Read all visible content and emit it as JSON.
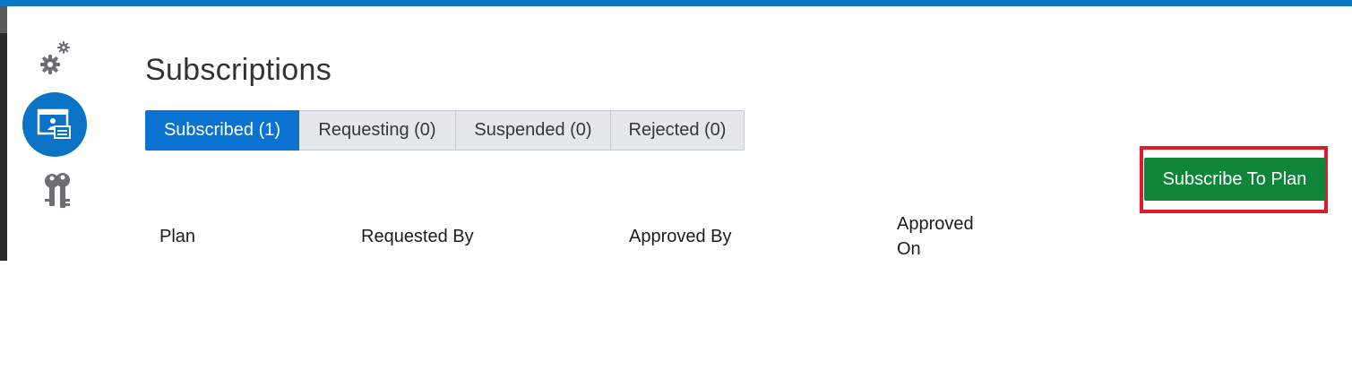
{
  "nav": {
    "items": [
      {
        "icon": "gears-icon",
        "active": false
      },
      {
        "icon": "subscriptions-icon",
        "active": true
      },
      {
        "icon": "keys-icon",
        "active": false
      }
    ]
  },
  "page": {
    "title": "Subscriptions"
  },
  "tabs": [
    {
      "label": "Subscribed (1)",
      "active": true
    },
    {
      "label": "Requesting (0)",
      "active": false
    },
    {
      "label": "Suspended (0)",
      "active": false
    },
    {
      "label": "Rejected (0)",
      "active": false
    }
  ],
  "actions": {
    "subscribe_label": "Subscribe To Plan"
  },
  "table": {
    "columns": [
      "Plan",
      "Requested By",
      "Approved By",
      "Approved On"
    ]
  },
  "colors": {
    "top_bar": "#0a78c7",
    "active_tab": "#0a73d1",
    "subscribe_button": "#0e8538",
    "highlight": "#e0192b"
  }
}
